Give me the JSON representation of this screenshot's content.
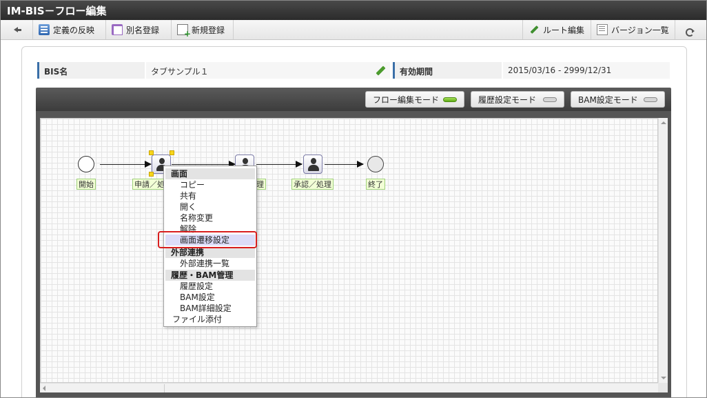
{
  "window": {
    "title": "IM-BIS－フロー編集"
  },
  "toolbar": {
    "reflect_label": "定義の反映",
    "alias_label": "別名登録",
    "new_label": "新規登録",
    "route_edit_label": "ルート編集",
    "version_list_label": "バージョン一覧"
  },
  "info": {
    "bis_name_label": "BIS名",
    "bis_name_value": "タブサンプル１",
    "period_label": "有効期間",
    "period_value": "2015/03/16  -  2999/12/31"
  },
  "modes": {
    "flow_edit": "フロー編集モード",
    "history_setting": "履歴設定モード",
    "bam_setting": "BAM設定モード",
    "active": "flow_edit"
  },
  "flow": {
    "nodes": [
      {
        "type": "start",
        "label": "開始"
      },
      {
        "type": "task",
        "label": "申請／処",
        "selected": true
      },
      {
        "type": "task",
        "label": "理"
      },
      {
        "type": "task",
        "label": "承認／処理"
      },
      {
        "type": "end",
        "label": "終了"
      }
    ]
  },
  "context_menu": {
    "sections": [
      {
        "header": "画面",
        "items": [
          "コピー",
          "共有",
          "開く",
          "名称変更",
          "解除",
          "画面遷移設定"
        ]
      },
      {
        "header": "外部連携",
        "items": [
          "外部連携一覧"
        ]
      },
      {
        "header": "履歴・BAM管理",
        "items": [
          "履歴設定",
          "BAM設定",
          "BAM詳細設定"
        ]
      }
    ],
    "bottom_item": "ファイル添付",
    "highlighted_item": "画面遷移設定"
  }
}
